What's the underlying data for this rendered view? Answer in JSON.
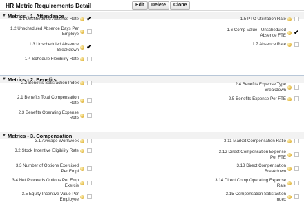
{
  "page": {
    "title": "HR Metric Requirements Detail",
    "buttons": {
      "edit": "Edit",
      "delete": "Delete",
      "clone": "Clone"
    }
  },
  "sections": [
    {
      "title": "Metrics - 1. Attendance",
      "fields": [
        {
          "label": "1.1 Unscheduled Absence Rate",
          "checked": true
        },
        {
          "label": "1.5 PTO Utilization Rate",
          "checked": false
        },
        {
          "label": "1.2 Unscheduled Absence Days Per Employe",
          "checked": false
        },
        {
          "label": "1.6 Comp Value - Unscheduled Absence FTE",
          "checked": true
        },
        {
          "label": "1.3 Unscheduled Absence Breakdown",
          "checked": true
        },
        {
          "label": "1.7 Absence Rate",
          "checked": false
        },
        {
          "label": "1.4 Schedule Flexibility Rate",
          "checked": false
        }
      ]
    },
    {
      "title": "Metrics - 2. Benefits",
      "fields": [
        {
          "label": "2.2 Benefits Satisfaction Index",
          "checked": false
        },
        {
          "label": "2.4 Benefits Expense Type Breakdown",
          "checked": false
        },
        {
          "label": "2.1 Benefits Total Compensation Rate",
          "checked": false
        },
        {
          "label": "2.5 Benefits Expense Per FTE",
          "checked": false
        },
        {
          "label": "2.3 Benefits Operating Expense Rate",
          "checked": false
        }
      ]
    },
    {
      "title": "Metrics - 3. Compensation",
      "fields": [
        {
          "label": "3.1 Average Workweek",
          "checked": false
        },
        {
          "label": "3.11 Market Compensation Ratio",
          "checked": false
        },
        {
          "label": "3.2 Stock Incentive Eligibility Rate",
          "checked": false
        },
        {
          "label": "3.12 Direct Compensation Expense Per FTE",
          "checked": false
        },
        {
          "label": "3.3 Number of Options Exercised Per Empl",
          "checked": false
        },
        {
          "label": "3.13 Direct Compensation Breakdown",
          "checked": false
        },
        {
          "label": "3.4 Net Proceeds Options Per Emp Exercis",
          "checked": false
        },
        {
          "label": "3.14 Direct Comp Operating Expense Rate",
          "checked": false
        },
        {
          "label": "3.5 Equity Incentive Value Per Employee",
          "checked": false
        },
        {
          "label": "3.15 Compensation Satisfaction Index",
          "checked": false
        }
      ]
    }
  ]
}
